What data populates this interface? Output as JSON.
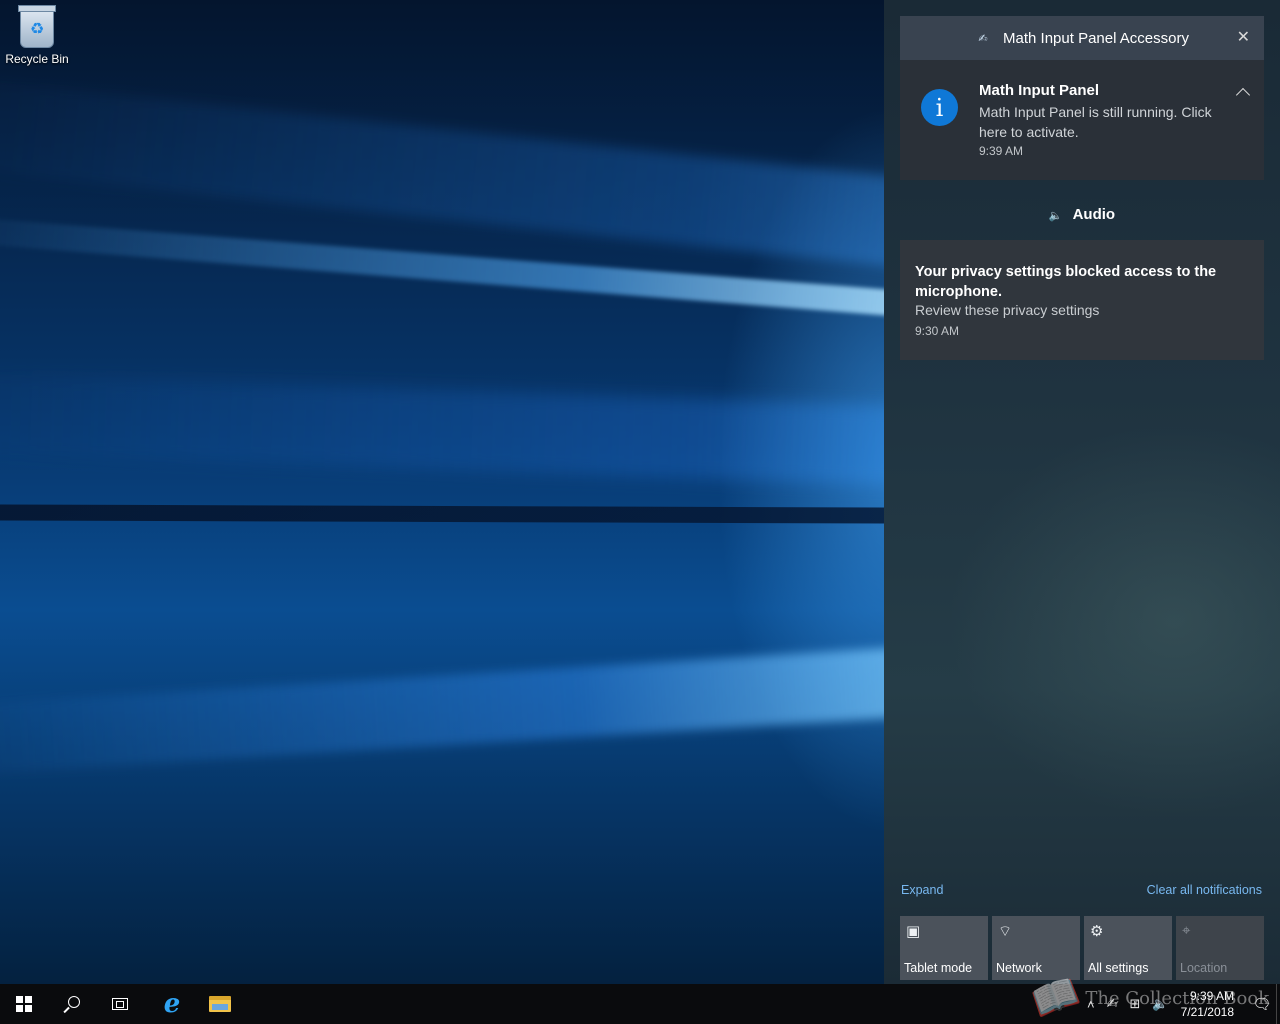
{
  "desktop": {
    "recycle_bin_label": "Recycle Bin"
  },
  "action_center": {
    "group": {
      "title": "Math Input Panel Accessory",
      "close_icon": "close-icon"
    },
    "notification_1": {
      "title": "Math Input Panel",
      "body": "Math Input Panel is still running. Click here to activate.",
      "time": "9:39 AM",
      "icon": "info-icon"
    },
    "audio_group_title": "Audio",
    "notification_2": {
      "title": "Your privacy settings blocked access to the microphone.",
      "body": "Review these privacy settings",
      "time": "9:30 AM"
    },
    "expand_label": "Expand",
    "clear_all_label": "Clear all notifications",
    "quick_actions": [
      {
        "label": "Tablet mode",
        "icon": "tablet-mode-icon"
      },
      {
        "label": "Network",
        "icon": "network-icon"
      },
      {
        "label": "All settings",
        "icon": "gear-icon"
      },
      {
        "label": "Location",
        "icon": "location-icon",
        "enabled": false
      }
    ]
  },
  "taskbar": {
    "time": "9:39 AM",
    "date": "7/21/2018"
  },
  "watermark": "The Collection Book",
  "colors": {
    "accent": "#0f78d7",
    "link": "#78b8f0",
    "panel": "#394350",
    "tile": "#4b525b"
  }
}
